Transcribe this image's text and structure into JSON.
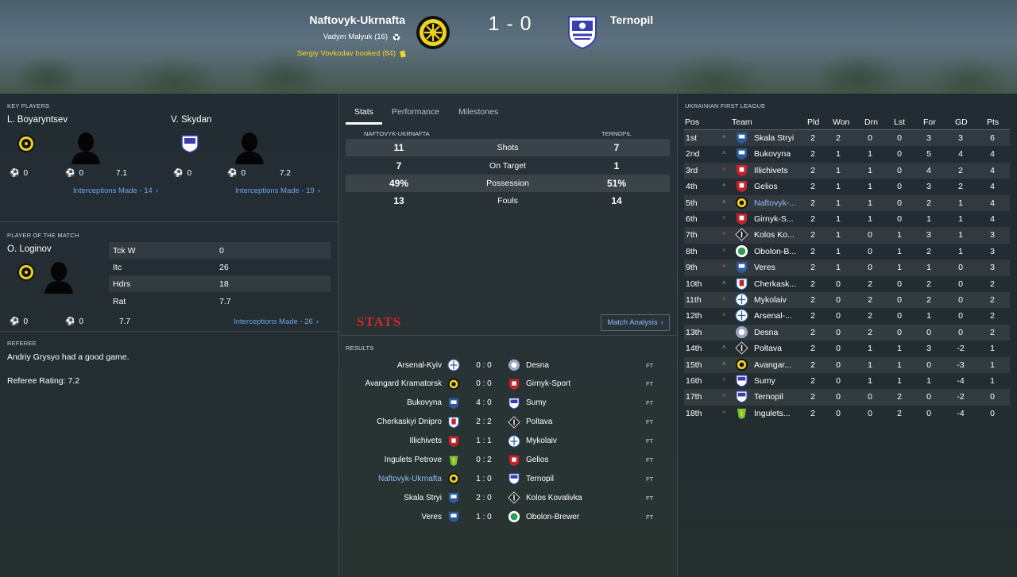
{
  "header": {
    "home_team": "Naftovyk-Ukrnafta",
    "away_team": "Ternopil",
    "score": "1 - 0",
    "home_goal": "Vadym Malyuk (16)",
    "home_booking": "Sergiy Vovkodav booked (84)"
  },
  "key_players": {
    "title": "KEY PLAYERS",
    "players": [
      {
        "name": "L. Boyaryntsev",
        "goals": "0",
        "assists": "0",
        "rating": "7.1",
        "link": "Interceptions Made - 14"
      },
      {
        "name": "V. Skydan",
        "goals": "0",
        "assists": "0",
        "rating": "7.2",
        "link": "Interceptions Made - 19"
      }
    ]
  },
  "potm": {
    "title": "PLAYER OF THE MATCH",
    "name": "O. Loginov",
    "stats": [
      {
        "label": "Tck W",
        "value": "0"
      },
      {
        "label": "Itc",
        "value": "26"
      },
      {
        "label": "Hdrs",
        "value": "18"
      },
      {
        "label": "Rat",
        "value": "7.7"
      }
    ],
    "goals": "0",
    "assists": "0",
    "rating": "7.7",
    "link": "Interceptions Made - 26"
  },
  "referee": {
    "title": "REFEREE",
    "comment": "Andriy Grysyo had a good game.",
    "rating": "Referee Rating: 7.2"
  },
  "tabs": [
    "Stats",
    "Performance",
    "Milestones"
  ],
  "match_stats": {
    "home_header": "NAFTOVYK-UKRNAFTA",
    "away_header": "TERNOPIL",
    "rows": [
      {
        "label": "Shots",
        "home": "11",
        "away": "7"
      },
      {
        "label": "On Target",
        "home": "7",
        "away": "1"
      },
      {
        "label": "Possession",
        "home": "49%",
        "away": "51%"
      },
      {
        "label": "Fouls",
        "home": "13",
        "away": "14"
      }
    ],
    "logo": "STATS",
    "analysis_button": "Match Analysis"
  },
  "results": {
    "title": "RESULTS",
    "rows": [
      {
        "home": "Arsenal-Kyiv",
        "score": "0 : 0",
        "away": "Desna",
        "status": "FT"
      },
      {
        "home": "Avangard Kramatorsk",
        "score": "0 : 0",
        "away": "Girnyk-Sport",
        "status": "FT"
      },
      {
        "home": "Bukovyna",
        "score": "4 : 0",
        "away": "Sumy",
        "status": "FT"
      },
      {
        "home": "Cherkaskyi Dnipro",
        "score": "2 : 2",
        "away": "Poltava",
        "status": "FT"
      },
      {
        "home": "Illichivets",
        "score": "1 : 1",
        "away": "Mykolaiv",
        "status": "FT"
      },
      {
        "home": "Ingulets Petrove",
        "score": "0 : 2",
        "away": "Gelios",
        "status": "FT"
      },
      {
        "home": "Naftovyk-Ukrnafta",
        "score": "1 : 0",
        "away": "Ternopil",
        "status": "FT"
      },
      {
        "home": "Skala Stryi",
        "score": "2 : 0",
        "away": "Kolos Kovalivka",
        "status": "FT"
      },
      {
        "home": "Veres",
        "score": "1 : 0",
        "away": "Obolon-Brewer",
        "status": "FT"
      }
    ]
  },
  "league": {
    "title": "UKRAINIAN FIRST LEAGUE",
    "headers": [
      "Pos",
      "Team",
      "Pld",
      "Won",
      "Drn",
      "Lst",
      "For",
      "GD",
      "Pts"
    ],
    "rows": [
      {
        "pos": "1st",
        "trend": "up",
        "team": "Skala Stryi",
        "pld": "2",
        "won": "2",
        "drn": "0",
        "lst": "0",
        "for": "3",
        "gd": "3",
        "pts": "6"
      },
      {
        "pos": "2nd",
        "trend": "up",
        "team": "Bukovyna",
        "pld": "2",
        "won": "1",
        "drn": "1",
        "lst": "0",
        "for": "5",
        "gd": "4",
        "pts": "4"
      },
      {
        "pos": "3rd",
        "trend": "down",
        "team": "Illichivets",
        "pld": "2",
        "won": "1",
        "drn": "1",
        "lst": "0",
        "for": "4",
        "gd": "2",
        "pts": "4"
      },
      {
        "pos": "4th",
        "trend": "up",
        "team": "Gelios",
        "pld": "2",
        "won": "1",
        "drn": "1",
        "lst": "0",
        "for": "3",
        "gd": "2",
        "pts": "4"
      },
      {
        "pos": "5th",
        "trend": "up",
        "team": "Naftovyk-...",
        "pld": "2",
        "won": "1",
        "drn": "1",
        "lst": "0",
        "for": "2",
        "gd": "1",
        "pts": "4"
      },
      {
        "pos": "6th",
        "trend": "down",
        "team": "Girnyk-S...",
        "pld": "2",
        "won": "1",
        "drn": "1",
        "lst": "0",
        "for": "1",
        "gd": "1",
        "pts": "4"
      },
      {
        "pos": "7th",
        "trend": "down",
        "team": "Kolos Ko...",
        "pld": "2",
        "won": "1",
        "drn": "0",
        "lst": "1",
        "for": "3",
        "gd": "1",
        "pts": "3"
      },
      {
        "pos": "8th",
        "trend": "down",
        "team": "Obolon-B...",
        "pld": "2",
        "won": "1",
        "drn": "0",
        "lst": "1",
        "for": "2",
        "gd": "1",
        "pts": "3"
      },
      {
        "pos": "9th",
        "trend": "down",
        "team": "Veres",
        "pld": "2",
        "won": "1",
        "drn": "0",
        "lst": "1",
        "for": "1",
        "gd": "0",
        "pts": "3"
      },
      {
        "pos": "10th",
        "trend": "up",
        "team": "Cherkask...",
        "pld": "2",
        "won": "0",
        "drn": "2",
        "lst": "0",
        "for": "2",
        "gd": "0",
        "pts": "2"
      },
      {
        "pos": "11th",
        "trend": "down",
        "team": "Mykolaiv",
        "pld": "2",
        "won": "0",
        "drn": "2",
        "lst": "0",
        "for": "2",
        "gd": "0",
        "pts": "2"
      },
      {
        "pos": "12th",
        "trend": "down",
        "team": "Arsenal-...",
        "pld": "2",
        "won": "0",
        "drn": "2",
        "lst": "0",
        "for": "1",
        "gd": "0",
        "pts": "2"
      },
      {
        "pos": "13th",
        "trend": "none",
        "team": "Desna",
        "pld": "2",
        "won": "0",
        "drn": "2",
        "lst": "0",
        "for": "0",
        "gd": "0",
        "pts": "2"
      },
      {
        "pos": "14th",
        "trend": "up",
        "team": "Poltava",
        "pld": "2",
        "won": "0",
        "drn": "1",
        "lst": "1",
        "for": "3",
        "gd": "-2",
        "pts": "1"
      },
      {
        "pos": "15th",
        "trend": "up",
        "team": "Avangar...",
        "pld": "2",
        "won": "0",
        "drn": "1",
        "lst": "1",
        "for": "0",
        "gd": "-3",
        "pts": "1"
      },
      {
        "pos": "16th",
        "trend": "down",
        "team": "Sumy",
        "pld": "2",
        "won": "0",
        "drn": "1",
        "lst": "1",
        "for": "1",
        "gd": "-4",
        "pts": "1"
      },
      {
        "pos": "17th",
        "trend": "down",
        "team": "Ternopil",
        "pld": "2",
        "won": "0",
        "drn": "0",
        "lst": "2",
        "for": "0",
        "gd": "-2",
        "pts": "0"
      },
      {
        "pos": "18th",
        "trend": "down",
        "team": "Ingulets...",
        "pld": "2",
        "won": "0",
        "drn": "0",
        "lst": "2",
        "for": "0",
        "gd": "-4",
        "pts": "0"
      }
    ]
  },
  "colors": {
    "accent_link": "#6fa7e8",
    "booking": "#f2d629",
    "trend_up": "#4fd08a",
    "trend_down": "#e05252",
    "stats_logo": "#d02828"
  }
}
